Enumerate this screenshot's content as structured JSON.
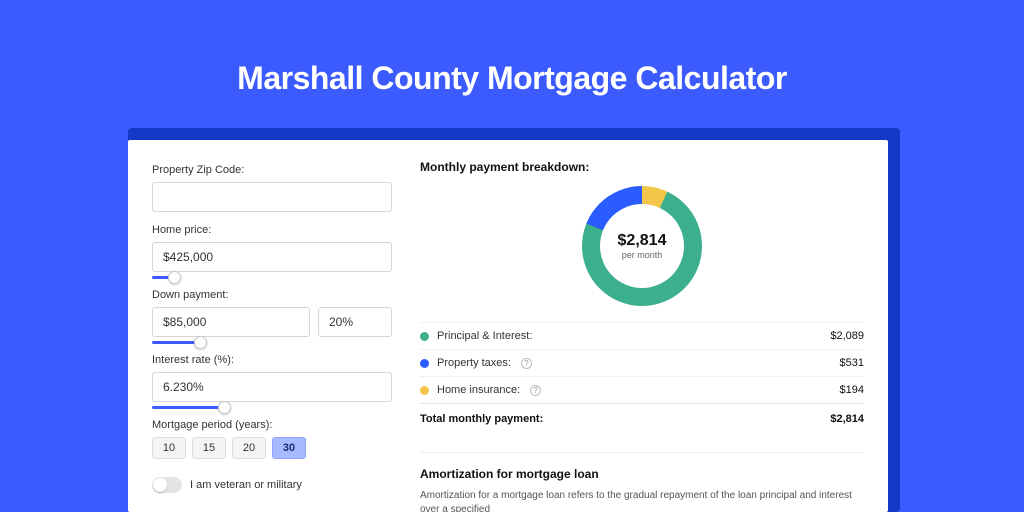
{
  "page": {
    "title": "Marshall County Mortgage Calculator"
  },
  "form": {
    "zip_label": "Property Zip Code:",
    "zip_value": "",
    "home_price_label": "Home price:",
    "home_price_value": "$425,000",
    "home_price_slider_pct": 9,
    "down_payment_label": "Down payment:",
    "down_payment_value": "$85,000",
    "down_payment_pct_value": "20%",
    "down_payment_slider_pct": 20,
    "interest_label": "Interest rate (%):",
    "interest_value": "6.230%",
    "interest_slider_pct": 30,
    "period_label": "Mortgage period (years):",
    "periods": [
      "10",
      "15",
      "20",
      "30"
    ],
    "period_selected": "30",
    "veteran_label": "I am veteran or military",
    "veteran_on": false
  },
  "breakdown": {
    "title": "Monthly payment breakdown:",
    "center_amount": "$2,814",
    "center_sub": "per month",
    "items": [
      {
        "key": "principal_interest",
        "label": "Principal & Interest:",
        "value": "$2,089",
        "color": "green",
        "info": false
      },
      {
        "key": "property_taxes",
        "label": "Property taxes:",
        "value": "$531",
        "color": "blue",
        "info": true
      },
      {
        "key": "home_insurance",
        "label": "Home insurance:",
        "value": "$194",
        "color": "yellow",
        "info": true
      }
    ],
    "total_label": "Total monthly payment:",
    "total_value": "$2,814"
  },
  "chart_data": {
    "type": "pie",
    "title": "Monthly payment breakdown",
    "series": [
      {
        "name": "Principal & Interest",
        "value": 2089,
        "color": "#3cb08e"
      },
      {
        "name": "Property taxes",
        "value": 531,
        "color": "#2b5cff"
      },
      {
        "name": "Home insurance",
        "value": 194,
        "color": "#f3c54a"
      }
    ],
    "total": 2814,
    "center_label": "$2,814 per month"
  },
  "amortization": {
    "title": "Amortization for mortgage loan",
    "text": "Amortization for a mortgage loan refers to the gradual repayment of the loan principal and interest over a specified"
  }
}
